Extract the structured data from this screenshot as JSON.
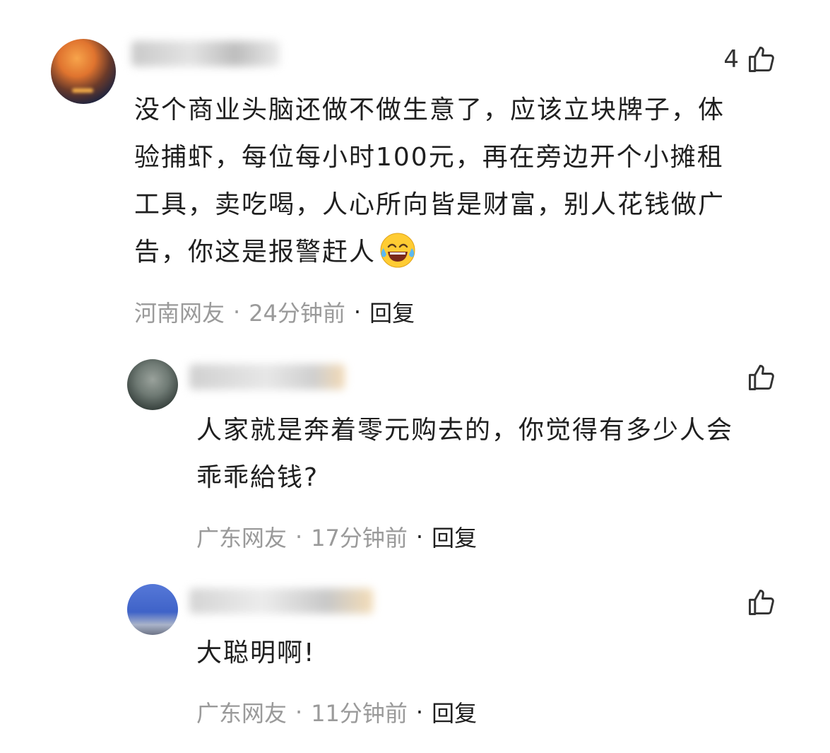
{
  "comments": [
    {
      "text": "没个商业头脑还做不做生意了，应该立块牌子，体验捕虾，每位每小时100元，再在旁边开个小摊租工具，卖吃喝，人心所向皆是财富，别人花钱做广告，你这是报警赶人",
      "emoji": "laughing-tears-emoji",
      "location": "河南网友",
      "time": "24分钟前",
      "reply_label": "回复",
      "like_count": "4"
    },
    {
      "text": "人家就是奔着零元购去的，你觉得有多少人会乖乖給钱?",
      "location": "广东网友",
      "time": "17分钟前",
      "reply_label": "回复",
      "like_count": ""
    },
    {
      "text": "大聪明啊!",
      "location": "广东网友",
      "time": "11分钟前",
      "reply_label": "回复",
      "like_count": ""
    }
  ],
  "separator": "·",
  "colors": {
    "text": "#1f1f1f",
    "meta": "#9a9a9a",
    "icon": "#333333"
  },
  "icons": {
    "like": "thumbs-up-icon"
  }
}
